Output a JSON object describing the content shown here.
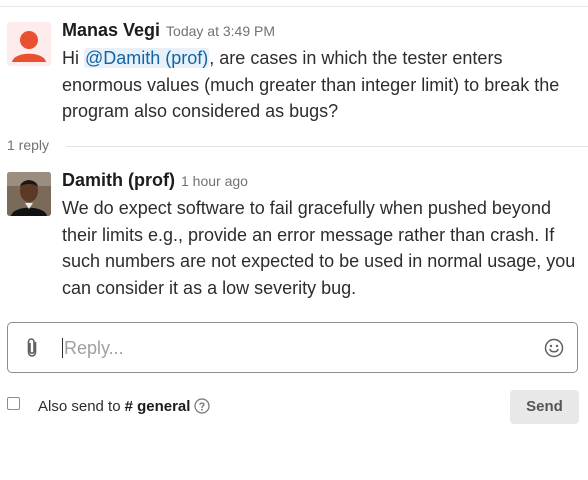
{
  "messages": [
    {
      "author": "Manas Vegi",
      "timestamp": "Today at 3:49 PM",
      "text_before": "Hi ",
      "mention": "@Damith (prof)",
      "text_after": ", are cases in which the tester enters enormous values (much greater than integer limit) to break the program also considered as bugs?",
      "avatar_icon": "default-user-avatar",
      "avatar_color": "#e8502f"
    },
    {
      "author": "Damith (prof)",
      "timestamp": "1 hour ago",
      "text": "We do expect software to fail gracefully when pushed beyond their limits e.g., provide an error message rather than crash. If such numbers are not expected to be used in normal usage, you can consider it as a low severity bug.",
      "avatar_icon": "user-photo-avatar"
    }
  ],
  "thread": {
    "reply_count": "1 reply"
  },
  "composer": {
    "placeholder": "Reply...",
    "attach_icon": "paperclip-icon",
    "emoji_icon": "smiley-icon",
    "also_send_label": "Also send to",
    "channel": "# general",
    "help_icon": "question-circle-icon",
    "send_label": "Send"
  }
}
